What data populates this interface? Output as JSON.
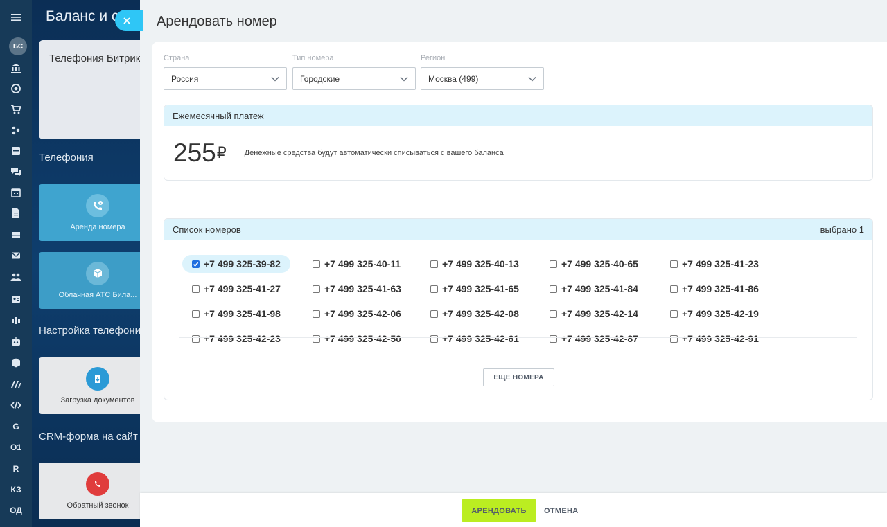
{
  "sidebar": {
    "avatar": "БС",
    "text_items": [
      "G",
      "O1",
      "R",
      "КЗ",
      "ОД"
    ]
  },
  "background": {
    "page_title": "Баланс и с",
    "card_title": "Телефония Битрик",
    "sections": [
      "Телефония",
      "Настройка телефони",
      "CRM-форма на сайт"
    ],
    "tiles": [
      {
        "label": "Аренда номера",
        "icon": "phone-coin-icon"
      },
      {
        "label": "Облачная АТС Била...",
        "icon": "cloud-box-icon"
      },
      {
        "label": "Загрузка документов",
        "icon": "document-upload-icon"
      },
      {
        "label": "Обратный звонок",
        "icon": "callback-icon"
      }
    ]
  },
  "slider": {
    "title": "Арендовать номер",
    "filters": {
      "country": {
        "label": "Страна",
        "value": "Россия"
      },
      "type": {
        "label": "Тип номера",
        "value": "Городские"
      },
      "region": {
        "label": "Регион",
        "value": "Москва (499)"
      }
    },
    "payment": {
      "header": "Ежемесячный платеж",
      "amount": "255",
      "currency": "₽",
      "note": "Денежные средства будут автоматически списываться с вашего баланса"
    },
    "numbers": {
      "header": "Список номеров",
      "selected_count": "выбрано 1",
      "items": [
        {
          "number": "+7 499 325-39-82",
          "checked": true
        },
        {
          "number": "+7 499 325-40-11",
          "checked": false
        },
        {
          "number": "+7 499 325-40-13",
          "checked": false
        },
        {
          "number": "+7 499 325-40-65",
          "checked": false
        },
        {
          "number": "+7 499 325-41-23",
          "checked": false
        },
        {
          "number": "+7 499 325-41-27",
          "checked": false
        },
        {
          "number": "+7 499 325-41-63",
          "checked": false
        },
        {
          "number": "+7 499 325-41-65",
          "checked": false
        },
        {
          "number": "+7 499 325-41-84",
          "checked": false
        },
        {
          "number": "+7 499 325-41-86",
          "checked": false
        },
        {
          "number": "+7 499 325-41-98",
          "checked": false
        },
        {
          "number": "+7 499 325-42-06",
          "checked": false
        },
        {
          "number": "+7 499 325-42-08",
          "checked": false
        },
        {
          "number": "+7 499 325-42-14",
          "checked": false
        },
        {
          "number": "+7 499 325-42-19",
          "checked": false
        },
        {
          "number": "+7 499 325-42-23",
          "checked": false
        },
        {
          "number": "+7 499 325-42-50",
          "checked": false
        },
        {
          "number": "+7 499 325-42-61",
          "checked": false
        },
        {
          "number": "+7 499 325-42-87",
          "checked": false
        },
        {
          "number": "+7 499 325-42-91",
          "checked": false
        }
      ],
      "more_label": "ЕЩЕ НОМЕРА"
    },
    "footer": {
      "rent_label": "АРЕНДОВАТЬ",
      "cancel_label": "ОТМЕНА"
    }
  },
  "colors": {
    "accent_green": "#bbed21",
    "header_blue": "#dcf3fc",
    "close_blue": "#2fc6f6",
    "checkbox_blue": "#1f6fe0"
  }
}
